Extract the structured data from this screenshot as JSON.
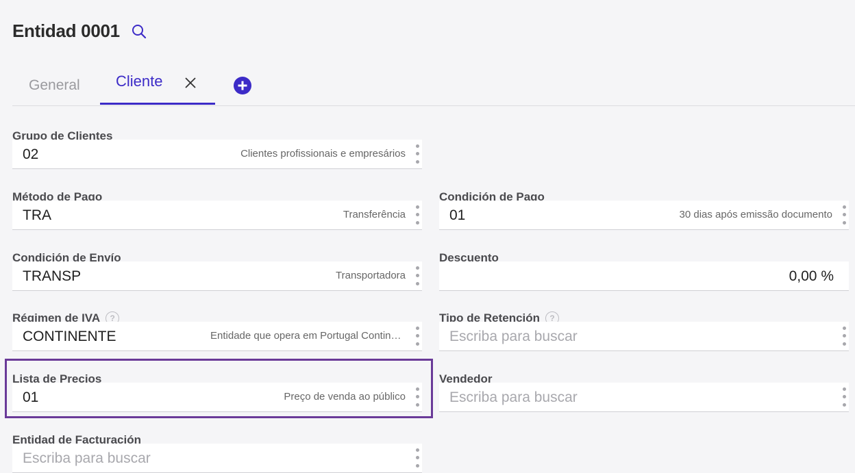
{
  "header": {
    "title": "Entidad 0001"
  },
  "tabs": {
    "general": "General",
    "cliente": "Cliente"
  },
  "fields": {
    "grupo_clientes": {
      "label": "Grupo de Clientes",
      "value": "02",
      "description": "Clientes profissionais e empresários"
    },
    "metodo_pago": {
      "label": "Método de Pago",
      "value": "TRA",
      "description": "Transferência"
    },
    "condicion_pago": {
      "label": "Condición de Pago",
      "value": "01",
      "description": "30 dias após emissão documento"
    },
    "condicion_envio": {
      "label": "Condición de Envío",
      "value": "TRANSP",
      "description": "Transportadora"
    },
    "descuento": {
      "label": "Descuento",
      "value": "0,00 %"
    },
    "regimen_iva": {
      "label": "Régimen de IVA",
      "help": "?",
      "value": "CONTINENTE",
      "description": "Entidade que opera em Portugal Continental"
    },
    "tipo_retencion": {
      "label": "Tipo de Retención",
      "help": "?",
      "placeholder": "Escriba para buscar"
    },
    "lista_precios": {
      "label": "Lista de Precios",
      "value": "01",
      "description": "Preço de venda ao público"
    },
    "vendedor": {
      "label": "Vendedor",
      "placeholder": "Escriba para buscar"
    },
    "entidad_facturacion": {
      "label": "Entidad de Facturación",
      "placeholder": "Escriba para buscar"
    }
  },
  "colors": {
    "accent": "#3c2bc7",
    "highlight": "#6a3a98"
  },
  "icons": {
    "search": "search-icon",
    "close": "close-icon",
    "add": "add-circle-icon",
    "more": "more-vert-icon",
    "help": "help-circle-icon"
  }
}
